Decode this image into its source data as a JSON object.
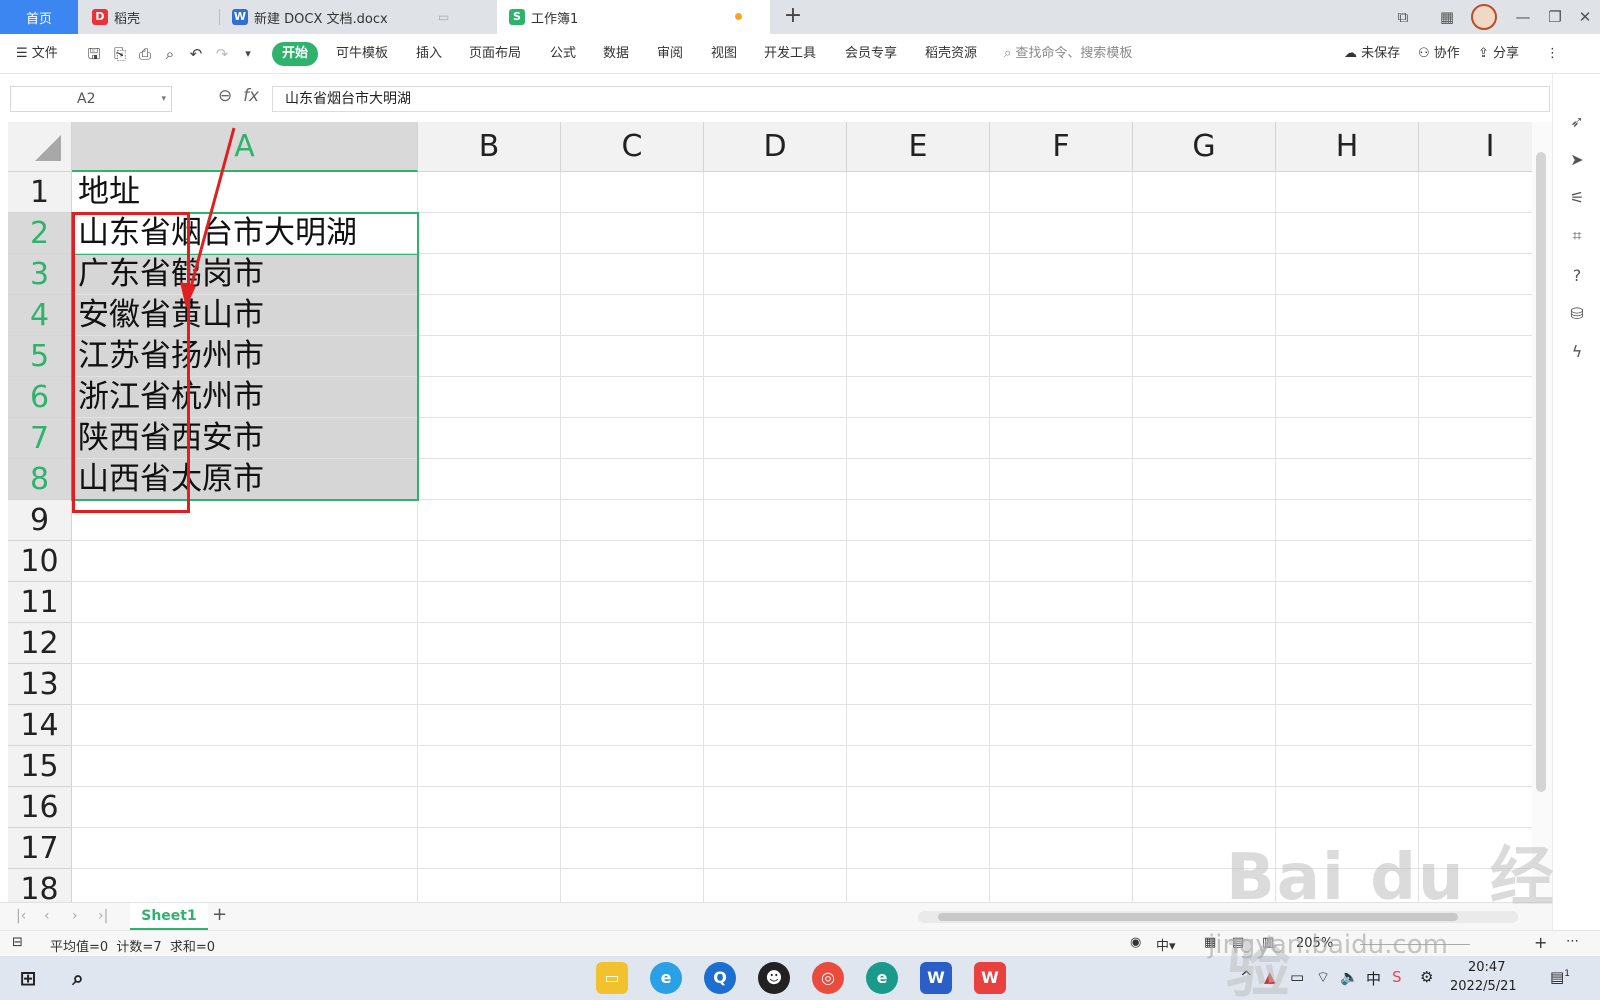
{
  "tabs": {
    "home": "首页",
    "docer": "稻壳",
    "docx": "新建 DOCX 文档.docx",
    "workbook": "工作簿1"
  },
  "menu": {
    "file": "文件",
    "items": [
      "开始",
      "可牛模板",
      "插入",
      "页面布局",
      "公式",
      "数据",
      "审阅",
      "视图",
      "开发工具",
      "会员专享",
      "稻壳资源"
    ],
    "search": "查找命令、搜索模板",
    "unsaved": "未保存",
    "collab": "协作",
    "share": "分享"
  },
  "formula": {
    "cell_ref": "A2",
    "fx": "fx",
    "value": "山东省烟台市大明湖"
  },
  "columns": [
    "A",
    "B",
    "C",
    "D",
    "E",
    "F",
    "G",
    "H",
    "I"
  ],
  "rows": [
    "1",
    "2",
    "3",
    "4",
    "5",
    "6",
    "7",
    "8",
    "9",
    "10",
    "11",
    "12",
    "13",
    "14",
    "15",
    "16",
    "17",
    "18"
  ],
  "cells": [
    "地址",
    "山东省烟台市大明湖",
    "广东省鹤岗市",
    "安徽省黄山市",
    "江苏省扬州市",
    "浙江省杭州市",
    "陕西省西安市",
    "山西省太原市"
  ],
  "sheet": {
    "name": "Sheet1"
  },
  "status": {
    "stats": "平均值=0  计数=7  求和=0",
    "zoom": "205%"
  },
  "taskbar": {
    "time": "20:47",
    "date": "2022/5/21",
    "ime": "中",
    "notif": "1"
  },
  "watermark": {
    "logo": "Bai du 经验",
    "url": "jingyan.baidu.com"
  },
  "colors": {
    "accent": "#2fb36c",
    "home_tab": "#3b86f0",
    "annotation": "#e02020"
  }
}
